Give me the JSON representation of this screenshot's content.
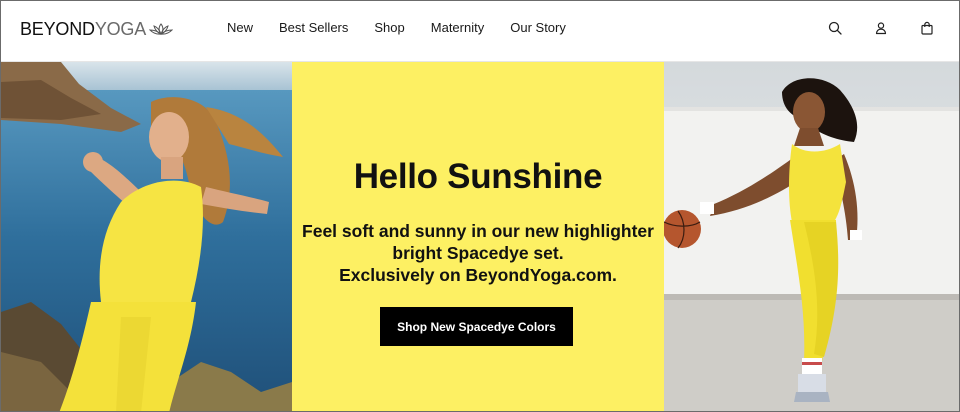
{
  "brand": {
    "logo_bold": "BEYOND",
    "logo_light": "YOGA",
    "accent_yellow": "#fdf063"
  },
  "nav": {
    "items": [
      {
        "label": "New"
      },
      {
        "label": "Best Sellers"
      },
      {
        "label": "Shop"
      },
      {
        "label": "Maternity"
      },
      {
        "label": "Our Story"
      }
    ]
  },
  "header_icons": [
    "search-icon",
    "account-icon",
    "shopping-bag-icon"
  ],
  "hero": {
    "title": "Hello Sunshine",
    "body_lines": [
      "Feel soft and sunny in our new highlighter",
      "bright Spacedye set.",
      "Exclusively on BeyondYoga.com."
    ],
    "cta_label": "Shop New Spacedye Colors"
  }
}
